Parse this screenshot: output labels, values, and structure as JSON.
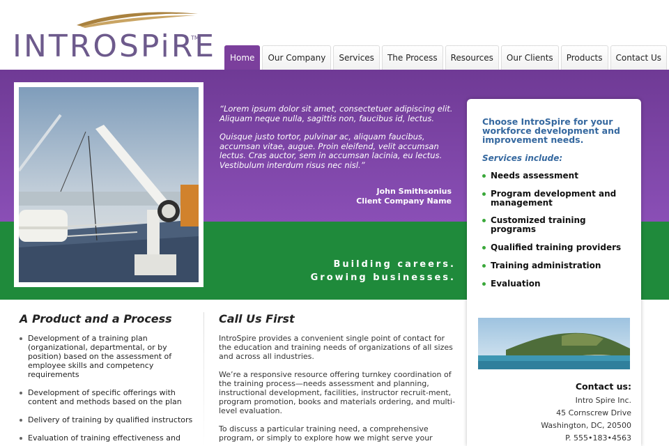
{
  "brand": {
    "name": "INTROSPiRE",
    "tm": "TM"
  },
  "nav": {
    "tabs": [
      {
        "label": "Home",
        "active": true
      },
      {
        "label": "Our Company"
      },
      {
        "label": "Services"
      },
      {
        "label": "The Process"
      },
      {
        "label": "Resources"
      },
      {
        "label": "Our Clients"
      },
      {
        "label": "Products"
      },
      {
        "label": "Contact Us"
      }
    ]
  },
  "hero": {
    "quote_p1": "“Lorem ipsum dolor sit amet, consectetuer adipiscing elit. Aliquam neque nulla, sagittis non, faucibus id, lectus.",
    "quote_p2": "Quisque justo tortor, pulvinar ac, aliquam faucibus, accumsan vitae, augue. Proin eleifend, velit accumsan lectus. Cras auctor, sem in accumsan lacinia, eu lectus. Vestibulum interdum risus nec nisl.”",
    "author_name": "John Smithsonius",
    "author_company": "Client Company Name",
    "tagline_1": "Building careers.",
    "tagline_2": "Growing businesses."
  },
  "panel": {
    "title": "Choose IntroSpire  for your workforce development and improvement needs.",
    "subtitle": "Services include:",
    "services": [
      "Needs assessment",
      "Program development and management",
      "Customized training programs",
      "Qualified training providers",
      "Training administration",
      "Evaluation"
    ],
    "contact": {
      "title": "Contact us:",
      "company": "Intro Spire Inc.",
      "street": "45 Cornscrew Drive",
      "city": "Washington, DC, 20500",
      "phone": "P. 555•183•4563"
    }
  },
  "product": {
    "title": "A Product and a Process",
    "items": [
      "Development of a training plan (organizational, departmental, or by position) based on the assessment of employee skills and competency requirements",
      "Development of specific offerings with content and methods based on the plan",
      "Delivery of training by qualified instructors",
      "Evaluation of training effectiveness and"
    ]
  },
  "call": {
    "title": "Call Us First",
    "p1": "IntroSpire provides a convenient single point of contact for the education and training needs of organizations of all sizes and across all industries.",
    "p2": "We’re a responsive resource offering turnkey coordination of the training process—needs assessment and planning, instructional development, facilities, instructor recruit-ment, program promotion, books and materials ordering, and multi-level evaluation.",
    "p3": "To discuss a particular training need, a comprehensive program, or simply to explore how we might serve your"
  },
  "colors": {
    "purple": "#7b3f9c",
    "green": "#1f8a3b",
    "panel_title": "#35689f",
    "bullet_green": "#3aa83a"
  },
  "icons": {
    "service_bullet": "green-dot-icon",
    "product_bullet": "gray-dot-icon"
  }
}
